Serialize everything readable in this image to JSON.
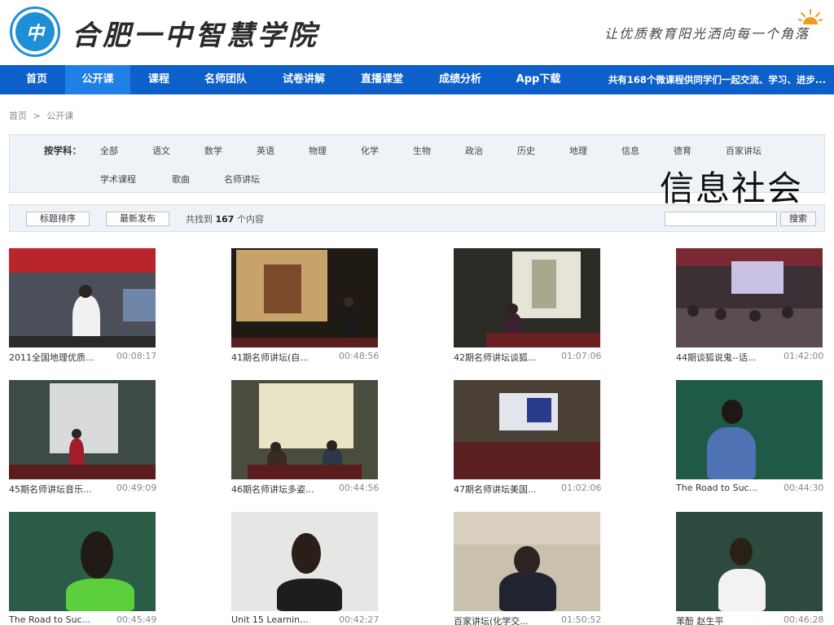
{
  "header": {
    "logo_mark": "中",
    "site_title": "合肥一中智慧学院",
    "slogan": "让优质教育阳光洒向每一个角落",
    "sun_icon": "sun-icon"
  },
  "nav": {
    "items": [
      "首页",
      "公开课",
      "课程",
      "名师团队",
      "试卷讲解",
      "直播课堂",
      "成绩分析",
      "App下载"
    ],
    "active_index": 1,
    "marquee": "共有168个微课程供同学们一起交流、学习、进步..."
  },
  "breadcrumb": {
    "home": "首页",
    "sep": ">",
    "current": "公开课"
  },
  "filter": {
    "label": "按学科：",
    "row1": [
      "全部",
      "语文",
      "数学",
      "英语",
      "物理",
      "化学",
      "生物",
      "政治",
      "历史",
      "地理",
      "信息",
      "德育",
      "百家讲坛"
    ],
    "row2": [
      "学术课程",
      "歌曲",
      "名师讲坛"
    ]
  },
  "overlay_text": "信息社会",
  "sortbar": {
    "sort_title": "标题排序",
    "sort_latest": "最新发布",
    "count_prefix": "共找到",
    "count_value": "167",
    "count_suffix": "个内容",
    "search_placeholder": "",
    "search_button": "搜索"
  },
  "videos": [
    {
      "title": "2011全国地理优质...",
      "duration": "00:08:17",
      "scene": "banner-stage"
    },
    {
      "title": "41期名师讲坛(自...",
      "duration": "00:48:56",
      "scene": "projector-portrait"
    },
    {
      "title": "42期名师讲坛谈狐...",
      "duration": "01:07:06",
      "scene": "projector-painting"
    },
    {
      "title": "44期谈狐说鬼--话...",
      "duration": "01:42:00",
      "scene": "audience-hall"
    },
    {
      "title": "45期名师讲坛音乐...",
      "duration": "00:49:09",
      "scene": "projector-slide"
    },
    {
      "title": "46期名师讲坛多姿...",
      "duration": "00:44:56",
      "scene": "projector-desk"
    },
    {
      "title": "47期名师讲坛美国...",
      "duration": "01:02:06",
      "scene": "projector-unity"
    },
    {
      "title": "The Road to Suc...",
      "duration": "00:44:30",
      "scene": "chalkboard-woman"
    },
    {
      "title": "The Road to Suc...",
      "duration": "00:45:49",
      "scene": "chalkboard-closeup"
    },
    {
      "title": "Unit 15 Learnin...",
      "duration": "00:42:27",
      "scene": "white-wall-woman"
    },
    {
      "title": "百家讲坛(化学交...",
      "duration": "01:50:52",
      "scene": "lecturer-mic"
    },
    {
      "title": "苯酚 赵生平",
      "duration": "00:46:28",
      "scene": "chalkboard-man"
    }
  ],
  "colors": {
    "nav_bg": "#0d5fc9",
    "nav_active": "#1f7fe6",
    "filter_bg": "#eef3f8",
    "logo_blue": "#1e8fd6"
  }
}
